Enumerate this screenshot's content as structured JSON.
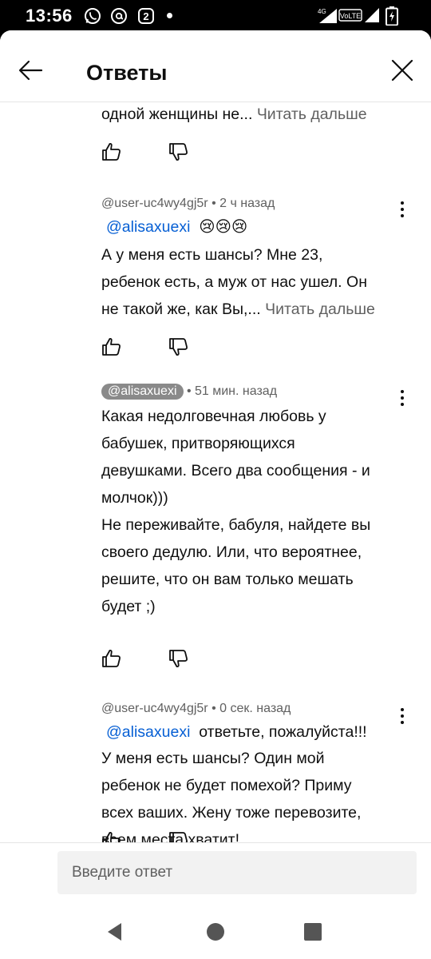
{
  "status_bar": {
    "time": "13:56",
    "notification_icons": [
      "whatsapp-icon",
      "at-sign-icon",
      "badge-2-icon"
    ],
    "notification_badge_number": "2",
    "network_label": "4G",
    "volte_label": "VoLTE"
  },
  "header": {
    "title": "Ответы"
  },
  "comments": [
    {
      "lines": [
        "одной женщины не..."
      ],
      "read_more": "Читать дальше"
    },
    {
      "author": "@user-uc4wy4gj5r",
      "time": "• 2 ч назад",
      "mention": "@alisaxuexi",
      "emoji": "😢😢😢",
      "lines": [
        "А у меня есть шансы? Мне 23,",
        "ребенок есть, а муж от нас ушел. Он",
        "не такой же, как Вы,..."
      ],
      "read_more": "Читать дальше"
    },
    {
      "author": "@alisaxuexi",
      "time": "• 51 мин. назад",
      "lines": [
        "Какая недолговечная любовь у",
        "бабушек, притворяющихся",
        "девушками. Всего два сообщения - и",
        "молчок)))",
        "Не переживайте, бабуля, найдете вы",
        "своего дедулю. Или, что вероятнее,",
        "решите, что он вам только мешать",
        "будет ;)"
      ]
    },
    {
      "author": "@user-uc4wy4gj5r",
      "time": "• 0 сек. назад",
      "mention": "@alisaxuexi",
      "first_line_rest": "ответьте, пожалуйста!!!",
      "lines": [
        "У меня есть шансы? Один мой",
        "ребенок не будет помехой? Приму",
        "всех ваших. Жену тоже перевозите,",
        "всем места хватит!"
      ]
    }
  ],
  "reply": {
    "placeholder": "Введите ответ"
  },
  "colors": {
    "accent_link": "#065fd4",
    "secondary_text": "#606060",
    "badge_bg": "#8a8a8a"
  }
}
